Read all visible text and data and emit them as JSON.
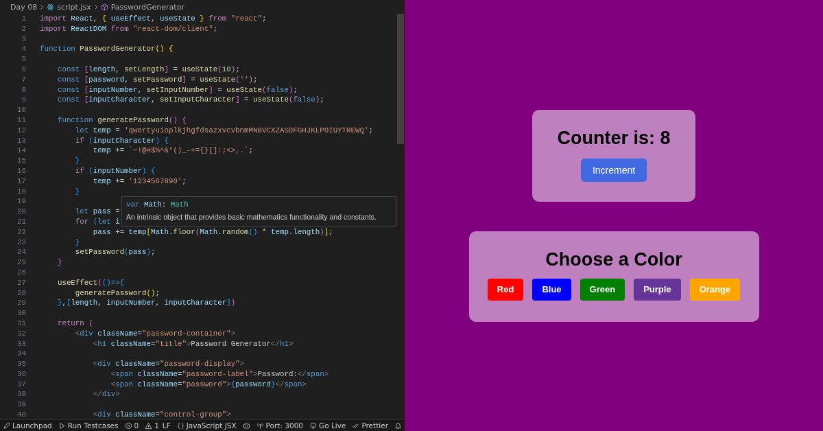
{
  "breadcrumb": {
    "folder": "Day 08",
    "file": "script.jsx",
    "symbol": "PasswordGenerator"
  },
  "editor": {
    "lines": [
      {
        "no": "1",
        "tokens": [
          {
            "kind": "k",
            "text": "import "
          },
          {
            "kind": "v",
            "text": "React"
          },
          {
            "kind": "p",
            "text": ", "
          },
          {
            "kind": "b1",
            "text": "{ "
          },
          {
            "kind": "v",
            "text": "useEffect"
          },
          {
            "kind": "p",
            "text": ", "
          },
          {
            "kind": "v",
            "text": "useState "
          },
          {
            "kind": "b1",
            "text": "} "
          },
          {
            "kind": "k",
            "text": "from "
          },
          {
            "kind": "st",
            "text": "\"react\""
          },
          {
            "kind": "p",
            "text": ";"
          }
        ]
      },
      {
        "no": "2",
        "tokens": [
          {
            "kind": "k",
            "text": "import "
          },
          {
            "kind": "v",
            "text": "ReactDOM "
          },
          {
            "kind": "k",
            "text": "from "
          },
          {
            "kind": "st",
            "text": "\"react-dom/client\""
          },
          {
            "kind": "p",
            "text": ";"
          }
        ]
      },
      {
        "no": "3"
      },
      {
        "no": "4",
        "tokens": [
          {
            "kind": "s",
            "text": "function "
          },
          {
            "kind": "f",
            "text": "PasswordGenerator"
          },
          {
            "kind": "b1",
            "text": "() {"
          }
        ]
      },
      {
        "no": "5"
      },
      {
        "no": "6",
        "tokens": [
          {
            "kind": "s",
            "text": "    const "
          },
          {
            "kind": "b2",
            "text": "["
          },
          {
            "kind": "v",
            "text": "length"
          },
          {
            "kind": "p",
            "text": ", "
          },
          {
            "kind": "f",
            "text": "setLength"
          },
          {
            "kind": "b2",
            "text": "]"
          },
          {
            "kind": "p",
            "text": " = "
          },
          {
            "kind": "f",
            "text": "useState"
          },
          {
            "kind": "b2",
            "text": "("
          },
          {
            "kind": "n",
            "text": "10"
          },
          {
            "kind": "b2",
            "text": ")"
          },
          {
            "kind": "p",
            "text": ";"
          }
        ]
      },
      {
        "no": "7",
        "tokens": [
          {
            "kind": "s",
            "text": "    const "
          },
          {
            "kind": "b2",
            "text": "["
          },
          {
            "kind": "v",
            "text": "password"
          },
          {
            "kind": "p",
            "text": ", "
          },
          {
            "kind": "f",
            "text": "setPassword"
          },
          {
            "kind": "b2",
            "text": "]"
          },
          {
            "kind": "p",
            "text": " = "
          },
          {
            "kind": "f",
            "text": "useState"
          },
          {
            "kind": "b2",
            "text": "("
          },
          {
            "kind": "st",
            "text": "''"
          },
          {
            "kind": "b2",
            "text": ")"
          },
          {
            "kind": "p",
            "text": ";"
          }
        ]
      },
      {
        "no": "8",
        "tokens": [
          {
            "kind": "s",
            "text": "    const "
          },
          {
            "kind": "b2",
            "text": "["
          },
          {
            "kind": "v",
            "text": "inputNumber"
          },
          {
            "kind": "p",
            "text": ", "
          },
          {
            "kind": "f",
            "text": "setInputNumber"
          },
          {
            "kind": "b2",
            "text": "]"
          },
          {
            "kind": "p",
            "text": " = "
          },
          {
            "kind": "f",
            "text": "useState"
          },
          {
            "kind": "b2",
            "text": "("
          },
          {
            "kind": "s",
            "text": "false"
          },
          {
            "kind": "b2",
            "text": ")"
          },
          {
            "kind": "p",
            "text": ";"
          }
        ]
      },
      {
        "no": "9",
        "tokens": [
          {
            "kind": "s",
            "text": "    const "
          },
          {
            "kind": "b2",
            "text": "["
          },
          {
            "kind": "v",
            "text": "inputCharacter"
          },
          {
            "kind": "p",
            "text": ", "
          },
          {
            "kind": "f",
            "text": "setInputCharacter"
          },
          {
            "kind": "b2",
            "text": "]"
          },
          {
            "kind": "p",
            "text": " = "
          },
          {
            "kind": "f",
            "text": "useState"
          },
          {
            "kind": "b2",
            "text": "("
          },
          {
            "kind": "s",
            "text": "false"
          },
          {
            "kind": "b2",
            "text": ")"
          },
          {
            "kind": "p",
            "text": ";"
          }
        ]
      },
      {
        "no": "10"
      },
      {
        "no": "11",
        "tokens": [
          {
            "kind": "s",
            "text": "    function "
          },
          {
            "kind": "f",
            "text": "generatePassword"
          },
          {
            "kind": "b2",
            "text": "() {"
          }
        ]
      },
      {
        "no": "12",
        "tokens": [
          {
            "kind": "s",
            "text": "        let "
          },
          {
            "kind": "v",
            "text": "temp"
          },
          {
            "kind": "p",
            "text": " = "
          },
          {
            "kind": "st",
            "text": "'qwertyuioplkjhgfdsazxvcvbnmMNBVCXZASDFGHJKLPOIUYTREWQ'"
          },
          {
            "kind": "p",
            "text": ";"
          }
        ]
      },
      {
        "no": "13",
        "tokens": [
          {
            "kind": "k",
            "text": "        if "
          },
          {
            "kind": "b3",
            "text": "("
          },
          {
            "kind": "v",
            "text": "inputCharacter"
          },
          {
            "kind": "b3",
            "text": ") {"
          }
        ]
      },
      {
        "no": "14",
        "tokens": [
          {
            "kind": "v",
            "text": "            temp"
          },
          {
            "kind": "p",
            "text": " += "
          },
          {
            "kind": "st",
            "text": "`~!@#$%^&*()_-+={}[]:;<>,.`"
          },
          {
            "kind": "p",
            "text": ";"
          }
        ]
      },
      {
        "no": "15",
        "tokens": [
          {
            "kind": "b3",
            "text": "        }"
          }
        ]
      },
      {
        "no": "16",
        "tokens": [
          {
            "kind": "k",
            "text": "        if "
          },
          {
            "kind": "b3",
            "text": "("
          },
          {
            "kind": "v",
            "text": "inputNumber"
          },
          {
            "kind": "b3",
            "text": ") {"
          }
        ]
      },
      {
        "no": "17",
        "tokens": [
          {
            "kind": "v",
            "text": "            temp"
          },
          {
            "kind": "p",
            "text": " += "
          },
          {
            "kind": "st",
            "text": "'1234567890'"
          },
          {
            "kind": "p",
            "text": ";"
          }
        ]
      },
      {
        "no": "18",
        "tokens": [
          {
            "kind": "b3",
            "text": "        }"
          }
        ]
      },
      {
        "no": "19"
      },
      {
        "no": "20",
        "tokens": [
          {
            "kind": "s",
            "text": "        let "
          },
          {
            "kind": "v",
            "text": "pass"
          },
          {
            "kind": "p",
            "text": " ="
          }
        ]
      },
      {
        "no": "21",
        "tokens": [
          {
            "kind": "k",
            "text": "        for "
          },
          {
            "kind": "b3",
            "text": "("
          },
          {
            "kind": "s",
            "text": "let "
          },
          {
            "kind": "v",
            "text": "i"
          }
        ]
      },
      {
        "no": "22",
        "tokens": [
          {
            "kind": "v",
            "text": "            pass"
          },
          {
            "kind": "p",
            "text": " += "
          },
          {
            "kind": "v",
            "text": "temp"
          },
          {
            "kind": "b1",
            "text": "["
          },
          {
            "kind": "v",
            "text": "Math"
          },
          {
            "kind": "p",
            "text": "."
          },
          {
            "kind": "f",
            "text": "floor"
          },
          {
            "kind": "b2",
            "text": "("
          },
          {
            "kind": "v",
            "text": "Math"
          },
          {
            "kind": "p",
            "text": "."
          },
          {
            "kind": "f",
            "text": "random"
          },
          {
            "kind": "b3",
            "text": "()"
          },
          {
            "kind": "p",
            "text": " * "
          },
          {
            "kind": "v",
            "text": "temp"
          },
          {
            "kind": "p",
            "text": "."
          },
          {
            "kind": "v",
            "text": "length"
          },
          {
            "kind": "b2",
            "text": ")"
          },
          {
            "kind": "b1",
            "text": "]"
          },
          {
            "kind": "p",
            "text": ";"
          }
        ]
      },
      {
        "no": "23",
        "tokens": [
          {
            "kind": "b3",
            "text": "        }"
          }
        ]
      },
      {
        "no": "24",
        "tokens": [
          {
            "kind": "f",
            "text": "        setPassword"
          },
          {
            "kind": "b3",
            "text": "("
          },
          {
            "kind": "v",
            "text": "pass"
          },
          {
            "kind": "b3",
            "text": ")"
          },
          {
            "kind": "p",
            "text": ";"
          }
        ]
      },
      {
        "no": "25",
        "tokens": [
          {
            "kind": "b2",
            "text": "    }"
          }
        ]
      },
      {
        "no": "26"
      },
      {
        "no": "27",
        "tokens": [
          {
            "kind": "f",
            "text": "    useEffect"
          },
          {
            "kind": "b2",
            "text": "("
          },
          {
            "kind": "b3",
            "text": "()"
          },
          {
            "kind": "s",
            "text": "=>"
          },
          {
            "kind": "b3",
            "text": "{"
          }
        ]
      },
      {
        "no": "28",
        "tokens": [
          {
            "kind": "f",
            "text": "        generatePassword"
          },
          {
            "kind": "b1",
            "text": "()"
          },
          {
            "kind": "p",
            "text": ";"
          }
        ]
      },
      {
        "no": "29",
        "tokens": [
          {
            "kind": "b3",
            "text": "    }"
          },
          {
            "kind": "p",
            "text": ","
          },
          {
            "kind": "b3",
            "text": "["
          },
          {
            "kind": "v",
            "text": "length"
          },
          {
            "kind": "p",
            "text": ", "
          },
          {
            "kind": "v",
            "text": "inputNumber"
          },
          {
            "kind": "p",
            "text": ", "
          },
          {
            "kind": "v",
            "text": "inputCharacter"
          },
          {
            "kind": "b3",
            "text": "]"
          },
          {
            "kind": "b2",
            "text": ")"
          }
        ]
      },
      {
        "no": "30"
      },
      {
        "no": "31",
        "tokens": [
          {
            "kind": "k",
            "text": "    return "
          },
          {
            "kind": "b2",
            "text": "("
          }
        ]
      },
      {
        "no": "32",
        "tokens": [
          {
            "kind": "tg",
            "text": "        <"
          },
          {
            "kind": "tn",
            "text": "div "
          },
          {
            "kind": "a",
            "text": "className"
          },
          {
            "kind": "p",
            "text": "="
          },
          {
            "kind": "st",
            "text": "\"password-container\""
          },
          {
            "kind": "tg",
            "text": ">"
          }
        ]
      },
      {
        "no": "33",
        "tokens": [
          {
            "kind": "tg",
            "text": "            <"
          },
          {
            "kind": "tn",
            "text": "h1 "
          },
          {
            "kind": "a",
            "text": "className"
          },
          {
            "kind": "p",
            "text": "="
          },
          {
            "kind": "st",
            "text": "\"title\""
          },
          {
            "kind": "tg",
            "text": ">"
          },
          {
            "kind": "p",
            "text": "Password Generator"
          },
          {
            "kind": "tg",
            "text": "</"
          },
          {
            "kind": "tn",
            "text": "h1"
          },
          {
            "kind": "tg",
            "text": ">"
          }
        ]
      },
      {
        "no": "34"
      },
      {
        "no": "35",
        "tokens": [
          {
            "kind": "tg",
            "text": "            <"
          },
          {
            "kind": "tn",
            "text": "div "
          },
          {
            "kind": "a",
            "text": "className"
          },
          {
            "kind": "p",
            "text": "="
          },
          {
            "kind": "st",
            "text": "\"password-display\""
          },
          {
            "kind": "tg",
            "text": ">"
          }
        ]
      },
      {
        "no": "36",
        "tokens": [
          {
            "kind": "tg",
            "text": "                <"
          },
          {
            "kind": "tn",
            "text": "span "
          },
          {
            "kind": "a",
            "text": "className"
          },
          {
            "kind": "p",
            "text": "="
          },
          {
            "kind": "st",
            "text": "\"password-label\""
          },
          {
            "kind": "tg",
            "text": ">"
          },
          {
            "kind": "p",
            "text": "Password:"
          },
          {
            "kind": "tg",
            "text": "</"
          },
          {
            "kind": "tn",
            "text": "span"
          },
          {
            "kind": "tg",
            "text": ">"
          }
        ]
      },
      {
        "no": "37",
        "tokens": [
          {
            "kind": "tg",
            "text": "                <"
          },
          {
            "kind": "tn",
            "text": "span "
          },
          {
            "kind": "a",
            "text": "className"
          },
          {
            "kind": "p",
            "text": "="
          },
          {
            "kind": "st",
            "text": "\"password\""
          },
          {
            "kind": "tg",
            "text": ">"
          },
          {
            "kind": "b3",
            "text": "{"
          },
          {
            "kind": "v",
            "text": "password"
          },
          {
            "kind": "b3",
            "text": "}"
          },
          {
            "kind": "tg",
            "text": "</"
          },
          {
            "kind": "tn",
            "text": "span"
          },
          {
            "kind": "tg",
            "text": ">"
          }
        ]
      },
      {
        "no": "38",
        "tokens": [
          {
            "kind": "tg",
            "text": "            </"
          },
          {
            "kind": "tn",
            "text": "div"
          },
          {
            "kind": "tg",
            "text": ">"
          }
        ]
      },
      {
        "no": "39"
      },
      {
        "no": "40",
        "tokens": [
          {
            "kind": "tg",
            "text": "            <"
          },
          {
            "kind": "tn",
            "text": "div "
          },
          {
            "kind": "a",
            "text": "className"
          },
          {
            "kind": "p",
            "text": "="
          },
          {
            "kind": "st",
            "text": "\"control-group\""
          },
          {
            "kind": "tg",
            "text": ">"
          }
        ]
      }
    ]
  },
  "hover": {
    "signature": [
      {
        "kind": "s",
        "text": "var "
      },
      {
        "kind": "v",
        "text": "Math"
      },
      {
        "kind": "p",
        "text": ": "
      },
      {
        "kind": "t",
        "text": "Math"
      }
    ],
    "doc": "An intrinsic object that provides basic mathematics functionality and constants."
  },
  "status_bar": {
    "left": [
      {
        "kind": "launchpad",
        "label": "Launchpad"
      },
      {
        "kind": "run",
        "label": "Run Testcases"
      },
      {
        "kind": "errors",
        "label": "0"
      },
      {
        "kind": "warnings",
        "label": "1"
      }
    ],
    "right": [
      {
        "kind": "text",
        "label": "LF"
      },
      {
        "kind": "language",
        "label": "JavaScript JSX"
      },
      {
        "kind": "copilot"
      },
      {
        "kind": "port",
        "label": "Port: 3000"
      },
      {
        "kind": "golive",
        "label": "Go Live"
      },
      {
        "kind": "prettier",
        "label": "Prettier"
      },
      {
        "kind": "bell"
      }
    ]
  },
  "preview": {
    "counter": {
      "title": "Counter is: 8",
      "button": "Increment"
    },
    "colors": {
      "title": "Choose a Color",
      "buttons": [
        {
          "label": "Red",
          "color": "#ff0000"
        },
        {
          "label": "Blue",
          "color": "#0000ff"
        },
        {
          "label": "Green",
          "color": "#008000"
        },
        {
          "label": "Purple",
          "color": "#663399"
        },
        {
          "label": "Orange",
          "color": "#ffa500"
        }
      ]
    }
  }
}
